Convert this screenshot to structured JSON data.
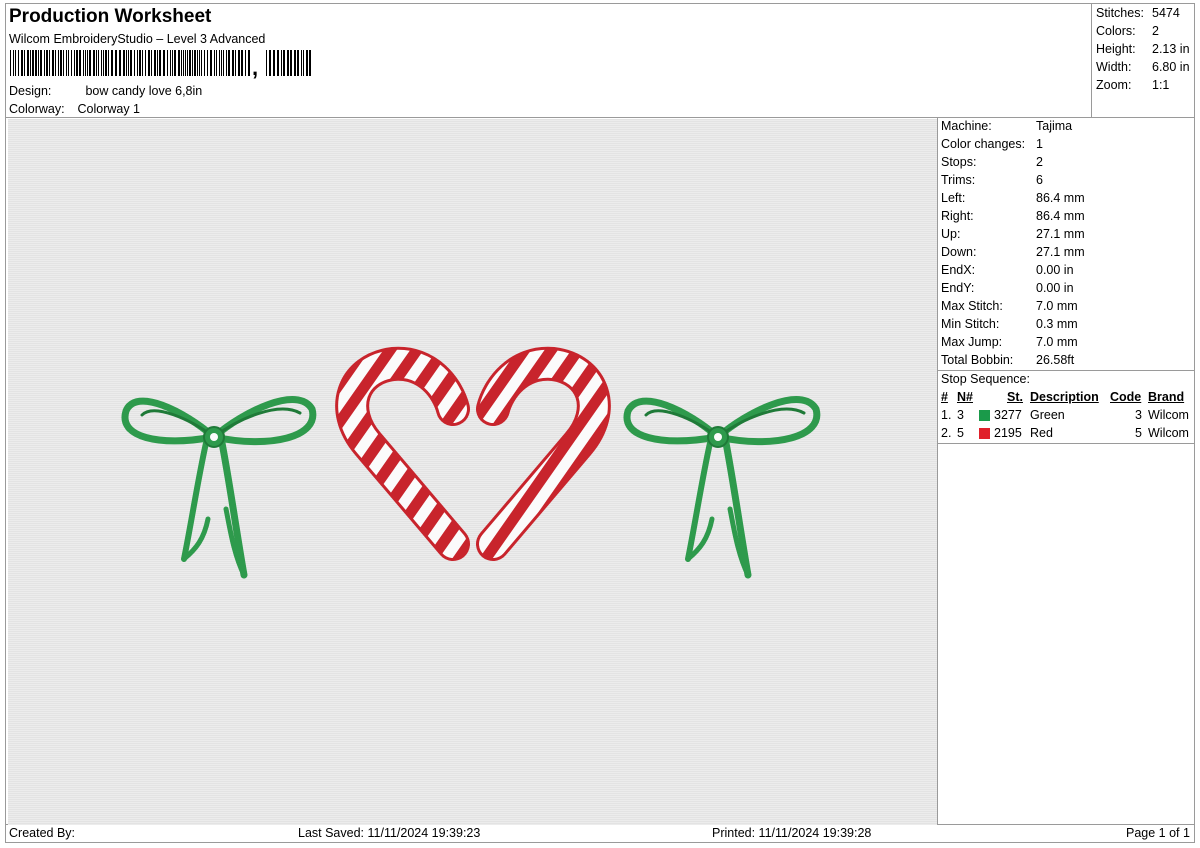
{
  "header": {
    "title": "Production Worksheet",
    "software": "Wilcom EmbroideryStudio – Level 3 Advanced",
    "barcode_suffix": ",",
    "design_label": "Design:",
    "design_value": "bow candy love 6,8in",
    "colorway_label": "Colorway:",
    "colorway_value": "Colorway 1"
  },
  "summary": [
    {
      "label": "Stitches:",
      "value": "5474"
    },
    {
      "label": "Colors:",
      "value": "2"
    },
    {
      "label": "Height:",
      "value": "2.13 in"
    },
    {
      "label": "Width:",
      "value": "6.80 in"
    },
    {
      "label": "Zoom:",
      "value": "1:1"
    }
  ],
  "machine_info": [
    {
      "label": "Machine:",
      "value": "Tajima"
    },
    {
      "label": "Color changes:",
      "value": "1"
    },
    {
      "label": "Stops:",
      "value": "2"
    },
    {
      "label": "Trims:",
      "value": "6"
    },
    {
      "label": "Left:",
      "value": "86.4 mm"
    },
    {
      "label": "Right:",
      "value": "86.4 mm"
    },
    {
      "label": "Up:",
      "value": "27.1 mm"
    },
    {
      "label": "Down:",
      "value": "27.1 mm"
    },
    {
      "label": "EndX:",
      "value": "0.00 in"
    },
    {
      "label": "EndY:",
      "value": "0.00 in"
    },
    {
      "label": "Max Stitch:",
      "value": "7.0 mm"
    },
    {
      "label": "Min Stitch:",
      "value": "0.3 mm"
    },
    {
      "label": "Max Jump:",
      "value": "7.0 mm"
    },
    {
      "label": "Total Bobbin:",
      "value": "26.58ft"
    }
  ],
  "stop_sequence": {
    "title": "Stop Sequence:",
    "headers": {
      "num": "#",
      "n": "N#",
      "st": "St.",
      "description": "Description",
      "code": "Code",
      "brand": "Brand"
    },
    "rows": [
      {
        "num": "1.",
        "n": "3",
        "color": "#1a9a4a",
        "st": "3277",
        "description": "Green",
        "code": "3",
        "brand": "Wilcom"
      },
      {
        "num": "2.",
        "n": "5",
        "color": "#e0202a",
        "st": "2195",
        "description": "Red",
        "code": "5",
        "brand": "Wilcom"
      }
    ]
  },
  "footer": {
    "created_by": "Created By:",
    "last_saved": "Last Saved: 11/11/2024 19:39:23",
    "printed": "Printed: 11/11/2024 19:39:28",
    "page": "Page 1 of 1"
  },
  "design_colors": {
    "green": "#2e9a4c",
    "green_dark": "#1f7a38",
    "red": "#c8242c",
    "red_light": "#e05050",
    "white": "#fbfbfb"
  }
}
